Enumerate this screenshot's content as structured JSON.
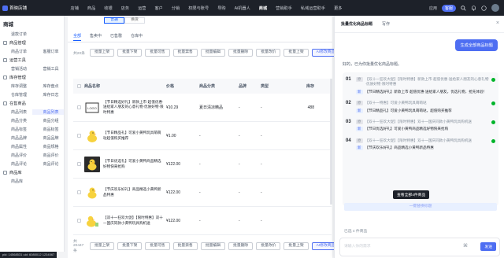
{
  "top": {
    "brand": "首映店铺",
    "nav": [
      "店铺",
      "商品",
      "收银",
      "店务",
      "运营",
      "客户",
      "分销",
      "权限与账号",
      "导购",
      "Ai机器人",
      "商城",
      "营销助手",
      "私域运营助手",
      "更多"
    ],
    "active": "商城",
    "pill": "客服",
    "apply": "应用"
  },
  "sidebar": {
    "title": "商城",
    "first_item": "退款订单",
    "groups": [
      {
        "label": "商品管理",
        "rows": [
          [
            "商品订单",
            "客服订单"
          ]
        ]
      },
      {
        "label": "运营工具",
        "rows": [
          [
            "营销活动",
            "营销工具"
          ]
        ]
      },
      {
        "label": "库存管理",
        "rows": [
          [
            "库存调整",
            "库存盘点"
          ],
          [
            "仓库管理",
            "库存日志"
          ]
        ]
      },
      {
        "label": "在售商品",
        "rows": [
          [
            "商品列表",
            "商品列表"
          ],
          [
            "商品分类",
            "商品分组"
          ],
          [
            "商品标签",
            "商品标签"
          ],
          [
            "商品品牌",
            "商品品牌"
          ],
          [
            "商品属性",
            "商品规格"
          ],
          [
            "商品评价",
            "商品评价"
          ],
          [
            "商品评论",
            "商品评论"
          ]
        ]
      },
      {
        "label": "商品库",
        "rows": [
          [
            "商品库",
            ""
          ]
        ]
      }
    ],
    "selected": "商品列表"
  },
  "main": {
    "segments": [
      "普通",
      "换货"
    ],
    "tabs": [
      "全部",
      "售卖中",
      "已售罄",
      "仓库中"
    ],
    "count_label": "共20条",
    "count_bottom": "共20447条",
    "actions": [
      "批量上架",
      "批量下架",
      "批量可售",
      "批量禁售",
      "批量编辑",
      "批量删除",
      "批量改价",
      "批量上架"
    ],
    "ai_action": "AI修改商品名称",
    "columns": [
      "商品名称",
      "价格",
      "商品分类",
      "品牌",
      "类型",
      "库存"
    ],
    "rows": [
      {
        "name": "【节日精选好礼】新款上市·超值优惠·送给家人朋友的心意礼物·优质好物·限时特惠",
        "price": "¥10.29",
        "cat": "夏日清凉精品",
        "brand": "-",
        "type": "-",
        "stock": "488"
      },
      {
        "name": "【节日精品礼】可爱小黄鸭玩具萌萌哒超值购买推荐",
        "price": "¥1.00",
        "cat": "-",
        "brand": "-",
        "type": "-",
        "stock": ""
      },
      {
        "name": "【节日优选礼】可爱小黄鸭商品精选好物快来抢购",
        "price": "¥122.00",
        "cat": "-",
        "brand": "-",
        "type": "-",
        "stock": ""
      },
      {
        "name": "【节庆欢乐好礼】商品精选小黄鸭新品特惠",
        "price": "¥122.00",
        "cat": "-",
        "brand": "-",
        "type": "-",
        "stock": ""
      },
      {
        "name": "【双十一狂欢大促】【限时特惠】双十一国庆同款小黄鸭玩具购机送",
        "price": "¥122.00",
        "cat": "-",
        "brand": "-",
        "type": "-",
        "stock": ""
      }
    ]
  },
  "panel": {
    "tabs": [
      "批量优化商品标题",
      "写作"
    ],
    "bubble": "生成全部商品标题",
    "message": "好的，已为你批量优化商品标题。",
    "items": [
      {
        "num": "01",
        "old_tag": "原",
        "old": "【双十一狂欢大促】【限时特惠】新款上市·超值优惠·送给家人朋友的心意礼物·优质好物·限时特惠",
        "new_tag": "新",
        "new": "【节日精选好礼】新款上市·超值优惠·送给家人朋友，优选礼物，抢先体验！"
      },
      {
        "num": "02",
        "old_tag": "原",
        "old": "【双十一特惠】可爱小黄鸭玩具萌萌哒",
        "new_tag": "新",
        "new": "【节日精品礼】可爱小黄鸭玩具萌萌哒，超值购买推荐"
      },
      {
        "num": "03",
        "old_tag": "原",
        "old": "【双十一狂欢大促】【限时特惠】双十一国庆同款小黄鸭玩具购机送",
        "new_tag": "新",
        "new": "【节日优选好礼】可爱小黄鸭商品精选好物快来抢购"
      },
      {
        "num": "04",
        "old_tag": "原",
        "old": "【双十一狂欢大促】【限时特惠】双十一国庆同款小黄鸭玩具购机送",
        "new_tag": "新",
        "new": "【节庆欢乐好礼】商品精选小黄鸭新品特惠"
      }
    ],
    "tooltip": "查看全部4件商品",
    "apply_button": "一键替换标题",
    "selected_note": "已选 4 件商品",
    "input_placeholder": "请输入你的需求",
    "send": "发送"
  },
  "status": "pid: 14568531 uid: 6080012 1234567"
}
